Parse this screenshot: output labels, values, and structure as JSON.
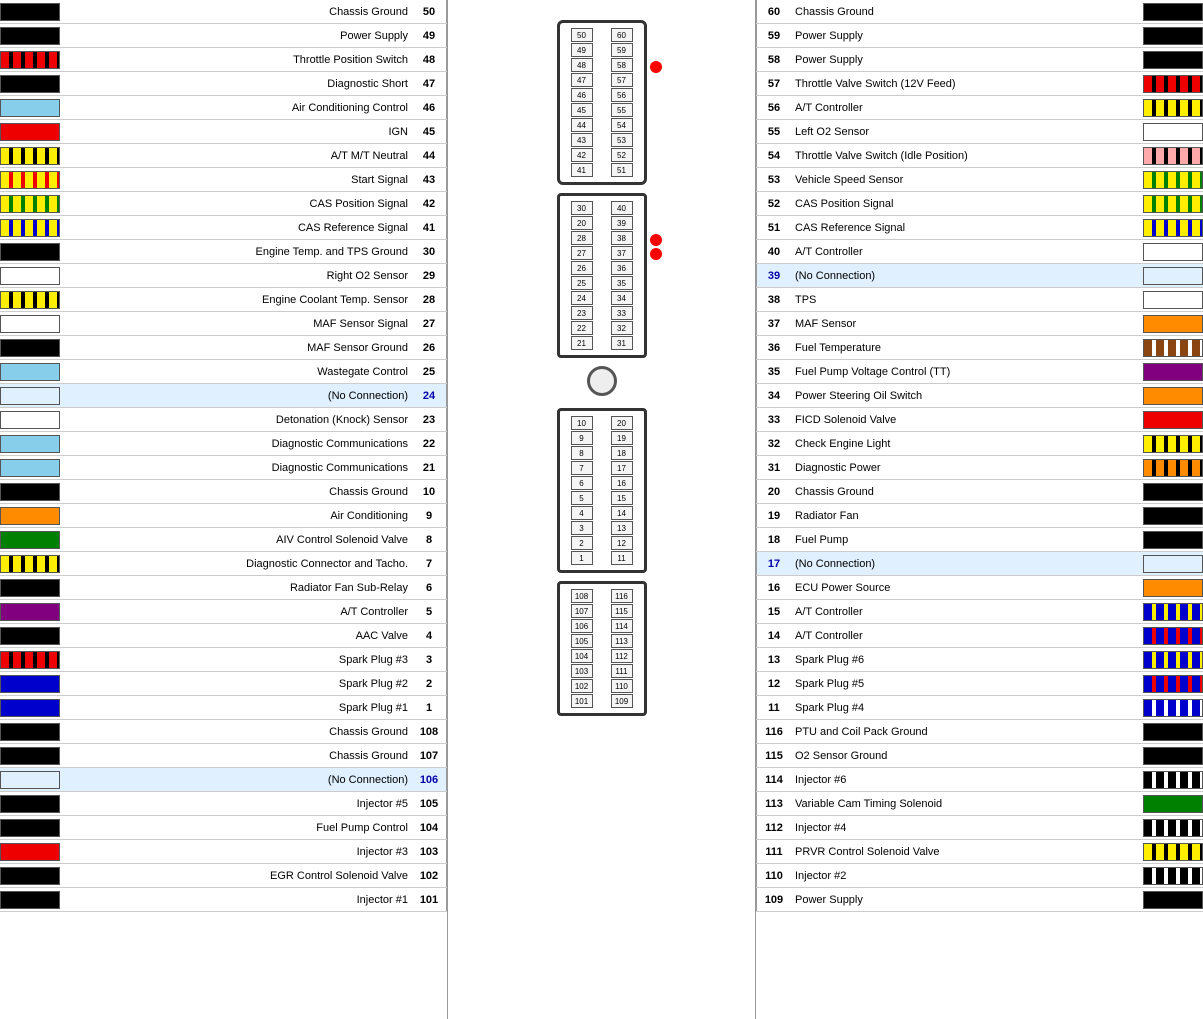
{
  "left": {
    "pins": [
      {
        "num": 50,
        "label": "Chassis Ground",
        "color": "black"
      },
      {
        "num": 49,
        "label": "Power Supply",
        "color": "black"
      },
      {
        "num": 48,
        "label": "Throttle Position Switch",
        "color": "multi-red-black"
      },
      {
        "num": 47,
        "label": "Diagnostic Short",
        "color": "black"
      },
      {
        "num": 46,
        "label": "Air Conditioning Control",
        "color": "light-blue"
      },
      {
        "num": 45,
        "label": "IGN",
        "color": "red"
      },
      {
        "num": 44,
        "label": "A/T M/T Neutral",
        "color": "multi-yellow-black"
      },
      {
        "num": 43,
        "label": "Start Signal",
        "color": "multi-yellow-red"
      },
      {
        "num": 42,
        "label": "CAS Position Signal",
        "color": "multi-yellow-green"
      },
      {
        "num": 41,
        "label": "CAS Reference Signal",
        "color": "multi-yellow-blue"
      },
      {
        "num": 30,
        "label": "Engine Temp. and TPS Ground",
        "color": "black"
      },
      {
        "num": 29,
        "label": "Right O2 Sensor",
        "color": "white"
      },
      {
        "num": 28,
        "label": "Engine Coolant Temp. Sensor",
        "color": "multi-yellow-black"
      },
      {
        "num": 27,
        "label": "MAF Sensor Signal",
        "color": "white"
      },
      {
        "num": 26,
        "label": "MAF Sensor Ground",
        "color": "black"
      },
      {
        "num": 25,
        "label": "Wastegate Control",
        "color": "light-blue"
      },
      {
        "num": 24,
        "label": "(No Connection)",
        "color": "none"
      },
      {
        "num": 23,
        "label": "Detonation (Knock) Sensor",
        "color": "white"
      },
      {
        "num": 22,
        "label": "Diagnostic Communications",
        "color": "light-blue"
      },
      {
        "num": 21,
        "label": "Diagnostic Communications",
        "color": "light-blue"
      },
      {
        "num": 10,
        "label": "Chassis Ground",
        "color": "black"
      },
      {
        "num": 9,
        "label": "Air Conditioning",
        "color": "orange"
      },
      {
        "num": 8,
        "label": "AIV Control Solenoid Valve",
        "color": "green"
      },
      {
        "num": 7,
        "label": "Diagnostic Connector and Tacho.",
        "color": "multi-yellow-black"
      },
      {
        "num": 6,
        "label": "Radiator Fan Sub-Relay",
        "color": "black"
      },
      {
        "num": 5,
        "label": "A/T Controller",
        "color": "purple"
      },
      {
        "num": 4,
        "label": "AAC Valve",
        "color": "black"
      },
      {
        "num": 3,
        "label": "Spark Plug #3",
        "color": "multi-red-black"
      },
      {
        "num": 2,
        "label": "Spark Plug #2",
        "color": "blue"
      },
      {
        "num": 1,
        "label": "Spark Plug #1",
        "color": "blue"
      },
      {
        "num": 108,
        "label": "Chassis Ground",
        "color": "black"
      },
      {
        "num": 107,
        "label": "Chassis Ground",
        "color": "black"
      },
      {
        "num": 106,
        "label": "(No Connection)",
        "color": "none"
      },
      {
        "num": 105,
        "label": "Injector #5",
        "color": "black"
      },
      {
        "num": 104,
        "label": "Fuel Pump Control",
        "color": "black"
      },
      {
        "num": 103,
        "label": "Injector #3",
        "color": "red"
      },
      {
        "num": 102,
        "label": "EGR Control Solenoid Valve",
        "color": "black"
      },
      {
        "num": 101,
        "label": "Injector #1",
        "color": "black"
      }
    ]
  },
  "right": {
    "pins": [
      {
        "num": 60,
        "label": "Chassis Ground",
        "color": "black"
      },
      {
        "num": 59,
        "label": "Power Supply",
        "color": "black"
      },
      {
        "num": 58,
        "label": "Power Supply",
        "color": "black"
      },
      {
        "num": 57,
        "label": "Throttle Valve Switch (12V Feed)",
        "color": "multi-red-black"
      },
      {
        "num": 56,
        "label": "A/T Controller",
        "color": "multi-yellow-black"
      },
      {
        "num": 55,
        "label": "Left O2 Sensor",
        "color": "white"
      },
      {
        "num": 54,
        "label": "Throttle Valve Switch (Idle Position)",
        "color": "multi-pink-black"
      },
      {
        "num": 53,
        "label": "Vehicle Speed Sensor",
        "color": "multi-yellow-green"
      },
      {
        "num": 52,
        "label": "CAS Position Signal",
        "color": "multi-yellow-green"
      },
      {
        "num": 51,
        "label": "CAS Reference Signal",
        "color": "multi-yellow-blue"
      },
      {
        "num": 40,
        "label": "A/T Controller",
        "color": "white"
      },
      {
        "num": 39,
        "label": "(No Connection)",
        "color": "none"
      },
      {
        "num": 38,
        "label": "TPS",
        "color": "white"
      },
      {
        "num": 37,
        "label": "MAF Sensor",
        "color": "orange"
      },
      {
        "num": 36,
        "label": "Fuel Temperature",
        "color": "multi-brown-white"
      },
      {
        "num": 35,
        "label": "Fuel Pump Voltage Control (TT)",
        "color": "purple"
      },
      {
        "num": 34,
        "label": "Power Steering Oil Switch",
        "color": "orange"
      },
      {
        "num": 33,
        "label": "FICD Solenoid Valve",
        "color": "red"
      },
      {
        "num": 32,
        "label": "Check Engine Light",
        "color": "multi-yellow-black"
      },
      {
        "num": 31,
        "label": "Diagnostic Power",
        "color": "multi-orange-black"
      },
      {
        "num": 20,
        "label": "Chassis Ground",
        "color": "black"
      },
      {
        "num": 19,
        "label": "Radiator Fan",
        "color": "black"
      },
      {
        "num": 18,
        "label": "Fuel Pump",
        "color": "black"
      },
      {
        "num": 17,
        "label": "(No Connection)",
        "color": "none"
      },
      {
        "num": 16,
        "label": "ECU Power Source",
        "color": "orange"
      },
      {
        "num": 15,
        "label": "A/T Controller",
        "color": "multi-blue-yellow"
      },
      {
        "num": 14,
        "label": "A/T Controller",
        "color": "multi-blue-red"
      },
      {
        "num": 13,
        "label": "Spark Plug #6",
        "color": "multi-blue-yellow"
      },
      {
        "num": 12,
        "label": "Spark Plug #5",
        "color": "multi-blue-red"
      },
      {
        "num": 11,
        "label": "Spark Plug #4",
        "color": "multi-blue-white"
      },
      {
        "num": 116,
        "label": "PTU and Coil Pack Ground",
        "color": "black"
      },
      {
        "num": 115,
        "label": "O2 Sensor Ground",
        "color": "black"
      },
      {
        "num": 114,
        "label": "Injector #6",
        "color": "multi-black-white"
      },
      {
        "num": 113,
        "label": "Variable Cam Timing Solenoid",
        "color": "green"
      },
      {
        "num": 112,
        "label": "Injector #4",
        "color": "multi-black-white"
      },
      {
        "num": 111,
        "label": "PRVR Control Solenoid Valve",
        "color": "multi-yellow-black"
      },
      {
        "num": 110,
        "label": "Injector #2",
        "color": "multi-black-white"
      },
      {
        "num": 109,
        "label": "Power Supply",
        "color": "black"
      }
    ]
  }
}
